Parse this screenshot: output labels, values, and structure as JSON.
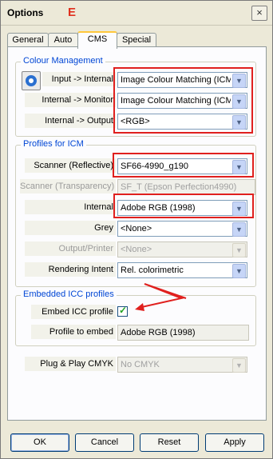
{
  "window": {
    "title": "Options",
    "annotation_letter": "E",
    "close_symbol": "×"
  },
  "tabs": [
    {
      "label": "General"
    },
    {
      "label": "Auto"
    },
    {
      "label": "CMS"
    },
    {
      "label": "Special"
    }
  ],
  "active_tab": "CMS",
  "colour_management": {
    "title": "Colour Management",
    "rows": [
      {
        "label": "Input -> Internal",
        "value": "Image Colour Matching (ICM)"
      },
      {
        "label": "Internal -> Monitor",
        "value": "Image Colour Matching (ICM)"
      },
      {
        "label": "Internal -> Output",
        "value": "<RGB>"
      }
    ]
  },
  "profiles": {
    "title": "Profiles for ICM",
    "rows": [
      {
        "label": "Scanner (Reflective)",
        "value": "SF66-4990_g190",
        "enabled": true
      },
      {
        "label": "Scanner (Transparency)",
        "value": "SF_T (Epson Perfection4990)",
        "enabled": false
      },
      {
        "label": "Internal",
        "value": "Adobe RGB (1998)",
        "enabled": true
      },
      {
        "label": "Grey",
        "value": "<None>",
        "enabled": true
      },
      {
        "label": "Output/Printer",
        "value": "<None>",
        "enabled": false
      },
      {
        "label": "Rendering Intent",
        "value": "Rel. colorimetric",
        "enabled": true
      }
    ]
  },
  "embedded": {
    "title": "Embedded ICC profiles",
    "embed_label": "Embed ICC profile",
    "embed_checked": true,
    "check_symbol": "✓",
    "profile_label": "Profile to embed",
    "profile_value": "Adobe RGB (1998)"
  },
  "plug_play": {
    "label": "Plug & Play CMYK",
    "value": "No CMYK"
  },
  "buttons": {
    "ok": "OK",
    "cancel": "Cancel",
    "reset": "Reset",
    "apply": "Apply"
  },
  "arrow_glyph": "▼",
  "colors": {
    "annotation_red": "#e0201e",
    "check_green": "#21a121",
    "group_title_blue": "#0046d5"
  }
}
